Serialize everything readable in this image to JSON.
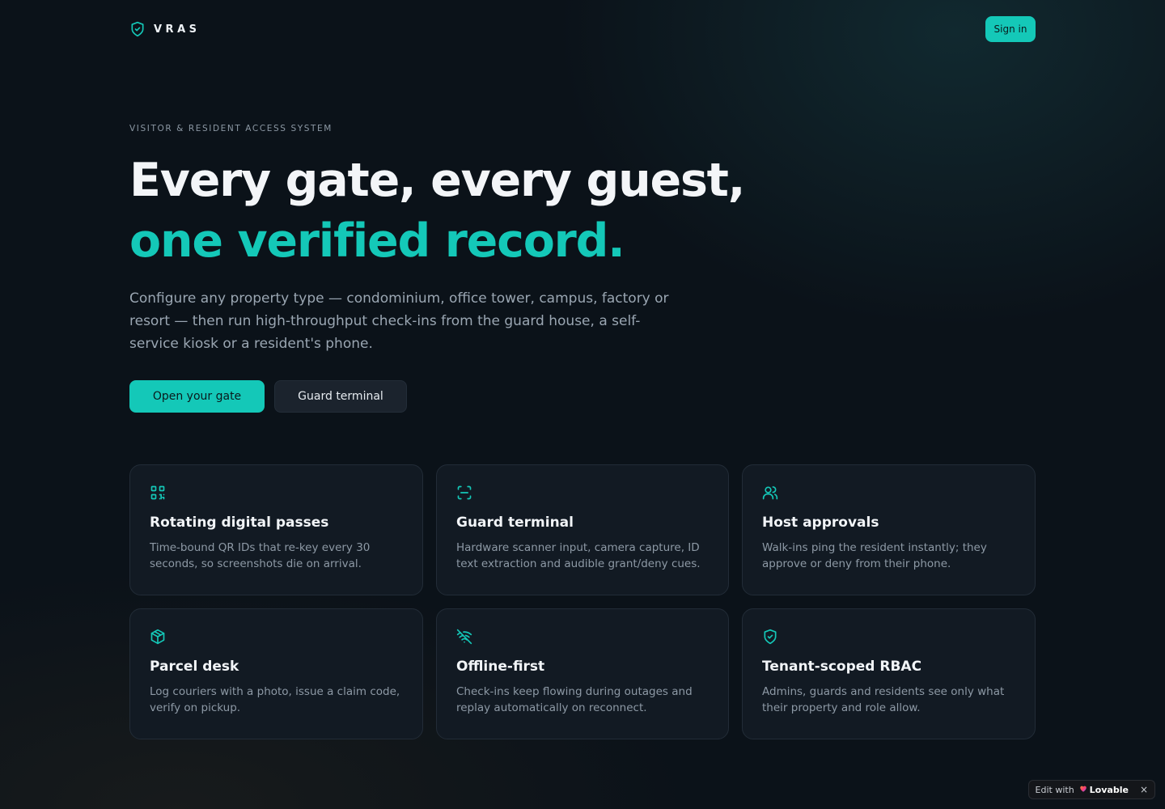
{
  "nav": {
    "brand": "VRAS",
    "brand_icon": "shield-check-icon",
    "signin_label": "Sign in"
  },
  "hero": {
    "eyebrow": "VISITOR & RESIDENT ACCESS SYSTEM",
    "headline_line1": "Every gate, every guest,",
    "headline_line2": "one verified record.",
    "description": "Configure any property type — condominium, office tower, campus, factory or resort — then run high-throughput check-ins from the guard house, a self-service kiosk or a resident's phone.",
    "primary_cta": "Open your gate",
    "secondary_cta": "Guard terminal"
  },
  "features": [
    {
      "icon": "qr-code-icon",
      "title": "Rotating digital passes",
      "description": "Time-bound QR IDs that re-key every 30 seconds, so screenshots die on arrival."
    },
    {
      "icon": "scan-icon",
      "title": "Guard terminal",
      "description": "Hardware scanner input, camera capture, ID text extraction and audible grant/deny cues."
    },
    {
      "icon": "users-icon",
      "title": "Host approvals",
      "description": "Walk-ins ping the resident instantly; they approve or deny from their phone."
    },
    {
      "icon": "package-icon",
      "title": "Parcel desk",
      "description": "Log couriers with a photo, issue a claim code, verify on pickup."
    },
    {
      "icon": "wifi-off-icon",
      "title": "Offline-first",
      "description": "Check-ins keep flowing during outages and replay automatically on reconnect."
    },
    {
      "icon": "shield-check-icon",
      "title": "Tenant-scoped RBAC",
      "description": "Admins, guards and residents see only what their property and role allow."
    }
  ],
  "badge": {
    "prefix": "Edit with",
    "brand": "Lovable",
    "close": "×"
  },
  "colors": {
    "accent": "#14c8b8",
    "background": "#0b1219",
    "card": "#121a23"
  }
}
